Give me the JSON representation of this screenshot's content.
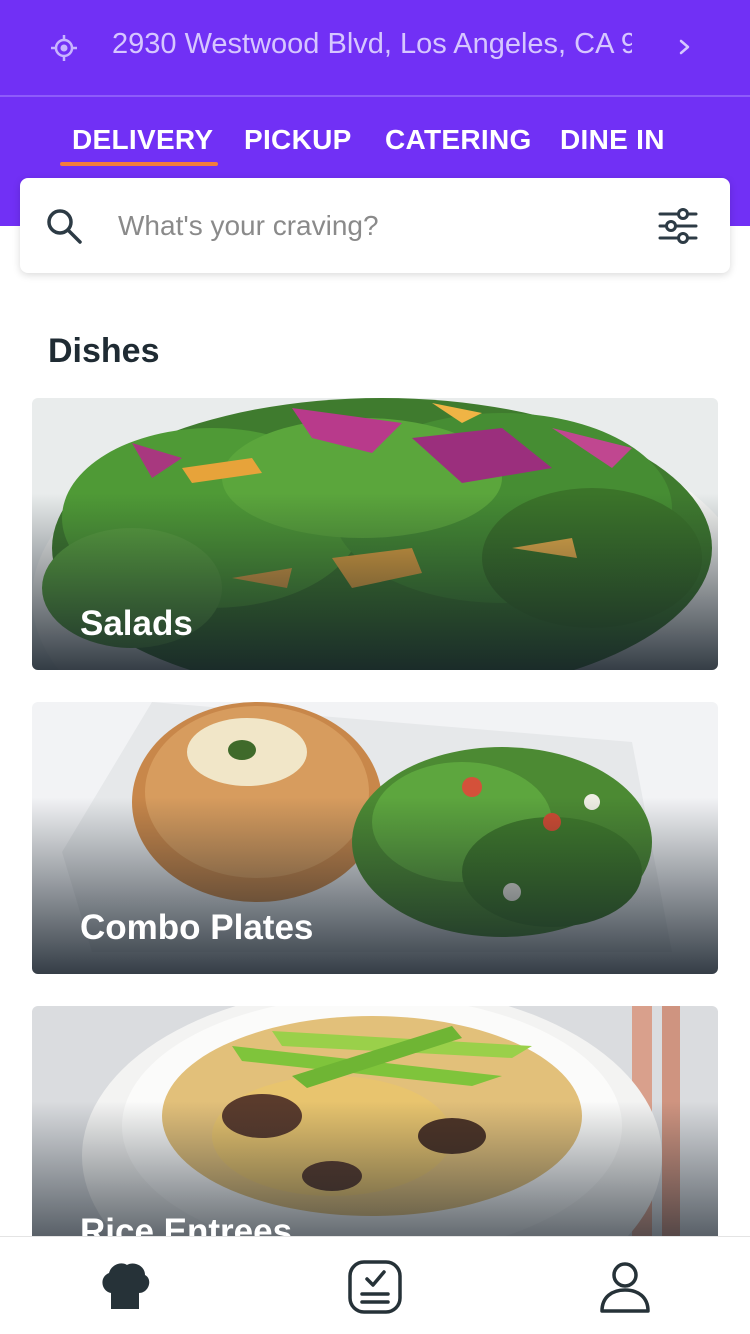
{
  "location": {
    "address": "2930 Westwood Blvd, Los Angeles, CA 9...",
    "icon": "location-target-icon",
    "chevron_icon": "chevron-right-icon"
  },
  "tabs": [
    {
      "label": "DELIVERY",
      "active": true
    },
    {
      "label": "PICKUP",
      "active": false
    },
    {
      "label": "CATERING",
      "active": false
    },
    {
      "label": "DINE IN",
      "active": false
    }
  ],
  "search": {
    "placeholder": "What's your craving?",
    "value": "",
    "icon": "search-icon",
    "filter_icon": "filter-sliders-icon"
  },
  "dishes": {
    "title": "Dishes",
    "items": [
      {
        "label": "Salads"
      },
      {
        "label": "Combo Plates"
      },
      {
        "label": "Rice Entrees"
      }
    ]
  },
  "bottom_nav": [
    {
      "icon": "chef-hat-icon",
      "active": true
    },
    {
      "icon": "order-checklist-icon",
      "active": false
    },
    {
      "icon": "user-profile-icon",
      "active": false
    }
  ],
  "colors": {
    "brand": "#7130F5",
    "tab_underline": "#F47C3C",
    "text_dark": "#1F2B33"
  }
}
